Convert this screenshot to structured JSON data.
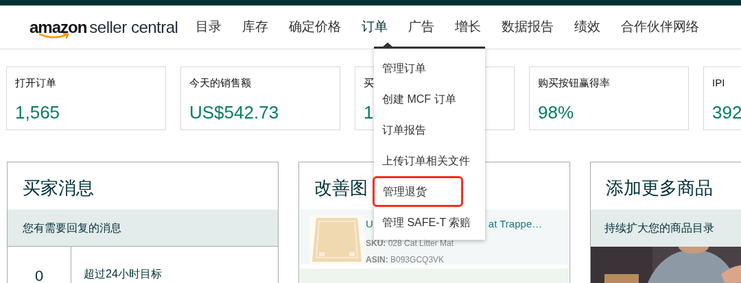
{
  "logo": {
    "brand": "amazon",
    "product": "seller central"
  },
  "nav": [
    {
      "label": "目录",
      "selected": false
    },
    {
      "label": "库存",
      "selected": false
    },
    {
      "label": "确定价格",
      "selected": false
    },
    {
      "label": "订单",
      "selected": true
    },
    {
      "label": "广告",
      "selected": false
    },
    {
      "label": "增长",
      "selected": false
    },
    {
      "label": "数据报告",
      "selected": false
    },
    {
      "label": "绩效",
      "selected": false
    },
    {
      "label": "合作伙伴网络",
      "selected": false
    }
  ],
  "metrics": [
    {
      "label": "打开订单",
      "value": "1,565"
    },
    {
      "label": "今天的销售额",
      "value": "US$542.73"
    },
    {
      "label": "买",
      "value": "1"
    },
    {
      "label": "购买按钮赢得率",
      "value": "98%"
    },
    {
      "label": "IPI",
      "value": "392"
    }
  ],
  "dropdown": [
    {
      "label": "管理订单",
      "highlighted": false
    },
    {
      "label": "创建 MCF 订单",
      "highlighted": false
    },
    {
      "label": "订单报告",
      "highlighted": false
    },
    {
      "label": "上传订单相关文件",
      "highlighted": false
    },
    {
      "label": "管理退货",
      "highlighted": true
    },
    {
      "label": "管理 SAFE-T 索赔",
      "highlighted": false
    }
  ],
  "buyer_messages": {
    "title": "买家消息",
    "subtitle": "您有需要回复的消息",
    "count": "0",
    "row_label": "超过24小时目标"
  },
  "listing_quality": {
    "title": "改善图",
    "product": {
      "title_start": "U",
      "title_end": "at Trappe…",
      "sku_label": "SKU:",
      "sku": "028 Cat Litter Mat",
      "asin_label": "ASIN:",
      "asin": "B093GCQ3VK"
    }
  },
  "add_products": {
    "title": "添加更多商品",
    "subtitle": "持续扩大您的商品目录",
    "kind": "picture"
  }
}
